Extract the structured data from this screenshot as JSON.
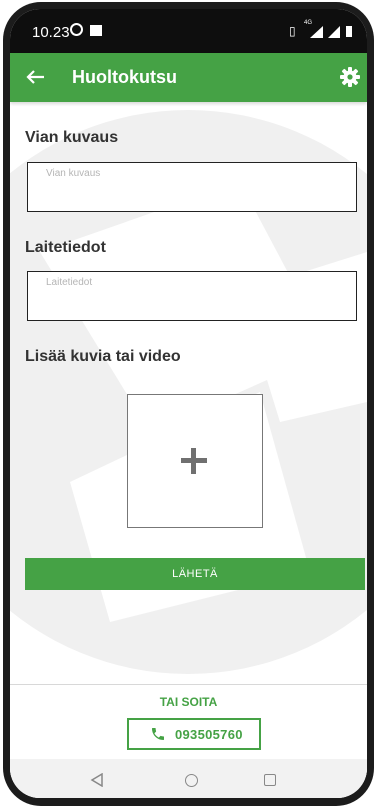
{
  "status_bar": {
    "time": "10.23",
    "icons": [
      "whatsapp-icon",
      "image-icon",
      "vibrate-icon",
      "4g-icon",
      "signal-icon",
      "signal-icon",
      "battery-icon"
    ],
    "network_label": "4G"
  },
  "app_bar": {
    "title": "Huoltokutsu",
    "back_icon": "arrow-left-icon",
    "settings_icon": "gear-icon"
  },
  "form": {
    "fault_description": {
      "label": "Vian kuvaus",
      "placeholder": "Vian kuvaus",
      "value": ""
    },
    "device_info": {
      "label": "Laitetiedot",
      "placeholder": "Laitetiedot",
      "value": ""
    },
    "media": {
      "label": "Lisää kuvia tai video",
      "add_icon": "plus-icon"
    },
    "submit_label": "LÄHETÄ"
  },
  "call": {
    "label": "TAI SOITA",
    "phone_number": "093505760",
    "icon": "phone-icon"
  },
  "navigation_bar": {
    "buttons": [
      "back-triangle-icon",
      "home-circle-icon",
      "recent-square-icon"
    ]
  },
  "colors": {
    "primary": "#45a245",
    "status_bar": "#0e0e0e",
    "text": "#333333",
    "placeholder": "#b5b5b5"
  }
}
